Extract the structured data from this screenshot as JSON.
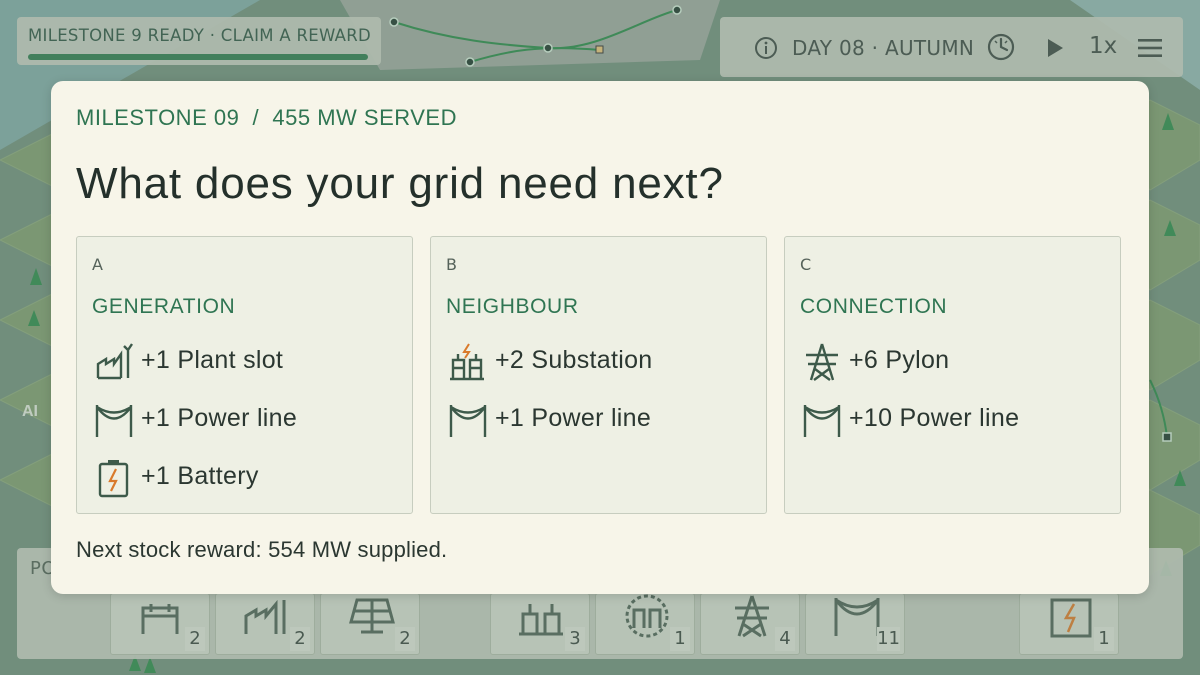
{
  "colors": {
    "accent": "#2f7552",
    "dialog_bg": "#f7f5e9",
    "card_bg": "#eef0e4",
    "icon_stroke": "#3d5a4a",
    "lightning": "#d97a2b"
  },
  "hud": {
    "milestone_status": "MILESTONE 9 READY · CLAIM A REWARD",
    "milestone_progress": 1.0,
    "day": "DAY 08 · AUTUMN",
    "speed": "1x",
    "icons": [
      "info-icon",
      "clock-icon",
      "play-icon",
      "menu-icon"
    ]
  },
  "toolbar": {
    "title_visible": "PO",
    "slots": [
      {
        "icon": "plant-icon",
        "count": "2"
      },
      {
        "icon": "factory-icon",
        "count": "2"
      },
      {
        "icon": "solar-panel-icon",
        "count": "2"
      },
      {
        "icon": "substation-icon",
        "count": "3"
      },
      {
        "icon": "dashed-substation-icon",
        "count": "1"
      },
      {
        "icon": "pylon-icon",
        "count": "4"
      },
      {
        "icon": "power-line-icon",
        "count": "11"
      },
      {
        "icon": "battery-icon",
        "count": "1"
      }
    ]
  },
  "dialog": {
    "kicker": "MILESTONE 09  /  455 MW SERVED",
    "heading": "What does your grid need next?",
    "footer": "Next stock reward: 554 MW supplied.",
    "cards": [
      {
        "letter": "A",
        "category": "GENERATION",
        "items": [
          {
            "icon": "plant-slot-icon",
            "label": "+1 Plant slot"
          },
          {
            "icon": "power-line-icon",
            "label": "+1 Power line"
          },
          {
            "icon": "battery-icon",
            "label": "+1 Battery"
          }
        ]
      },
      {
        "letter": "B",
        "category": "NEIGHBOUR",
        "items": [
          {
            "icon": "substation-icon",
            "label": "+2 Substation"
          },
          {
            "icon": "power-line-icon",
            "label": "+1 Power line"
          }
        ]
      },
      {
        "letter": "C",
        "category": "CONNECTION",
        "items": [
          {
            "icon": "pylon-icon",
            "label": "+6 Pylon"
          },
          {
            "icon": "power-line-icon",
            "label": "+10 Power line"
          }
        ]
      }
    ]
  }
}
